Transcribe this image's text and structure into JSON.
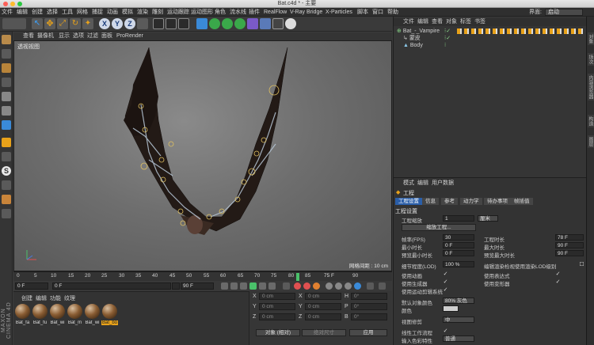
{
  "window": {
    "title": "Bat.c4d * - 主要"
  },
  "menubar": {
    "items": [
      "文件",
      "编辑",
      "创建",
      "选择",
      "工具",
      "网格",
      "捕捉",
      "动画",
      "模拟",
      "渲染",
      "雕刻",
      "运动跟踪",
      "运动图形",
      "角色",
      "流水线",
      "插件",
      "RealFlow",
      "V-Ray Bridge",
      "X-Particles",
      "脚本",
      "窗口",
      "帮助"
    ],
    "interface_label": "界面:",
    "interface_value": "启动"
  },
  "viewport": {
    "menu": [
      "查看",
      "摄像机",
      "显示",
      "选项",
      "过滤",
      "面板",
      "ProRender"
    ],
    "label": "透视视图",
    "grid_label": "网格间距 : 10 cm"
  },
  "timeline": {
    "ticks": [
      "0",
      "5",
      "10",
      "15",
      "20",
      "25",
      "30",
      "35",
      "40",
      "45",
      "50",
      "55",
      "60",
      "65",
      "70",
      "75",
      "80",
      "85",
      "90"
    ],
    "playhead_pct": 83.3,
    "current_frame": "75 F"
  },
  "playbar": {
    "start": "0 F",
    "current": "0 F",
    "end_preview": "90 F",
    "end": "90 F"
  },
  "materials": {
    "menu": [
      "创建",
      "编辑",
      "功能",
      "纹理"
    ],
    "items": [
      "Bat_fa",
      "Bat_fu",
      "Bat_wi",
      "Bat_m",
      "Bat_wi",
      "Bat_bo"
    ],
    "selected_index": 5
  },
  "brand": "MAXON CINEMA 4D",
  "coordinates": {
    "rows": [
      {
        "a": "X",
        "av": "0 cm",
        "b": "X",
        "bv": "0 cm",
        "c": "H",
        "cv": "0°"
      },
      {
        "a": "Y",
        "av": "0 cm",
        "b": "Y",
        "bv": "0 cm",
        "c": "P",
        "cv": "0°"
      },
      {
        "a": "Z",
        "av": "0 cm",
        "b": "Z",
        "bv": "0 cm",
        "c": "B",
        "cv": "0°"
      }
    ],
    "mode": "对象 (相对)",
    "size_mode": "绝对尺寸",
    "apply": "应用"
  },
  "object_manager": {
    "menu": [
      "文件",
      "编辑",
      "查看",
      "对象",
      "标签",
      "书签"
    ],
    "objects": [
      {
        "name": "Bat_-_Vampire",
        "indent": 0
      },
      {
        "name": "蒙皮",
        "indent": 1
      },
      {
        "name": "Body",
        "indent": 1
      }
    ]
  },
  "right_strip": [
    "对象",
    "场次",
    "内容浏览器",
    "构造",
    "图层"
  ],
  "attributes": {
    "menu": [
      "模式",
      "编辑",
      "用户数据"
    ],
    "title": "工程",
    "tabs": [
      "工程设置",
      "信息",
      "参考",
      "动力学",
      "待办事项",
      "帧插值"
    ],
    "active_tab": 0,
    "section": "工程设置",
    "scale_label": "工程缩放",
    "scale_value": "1",
    "scale_unit": "厘米",
    "scale_button": "缩放工程...",
    "fps_label": "帧率(FPS)",
    "fps_value": "30",
    "proj_len_label": "工程时长",
    "proj_len_value": "78 F",
    "min_label": "最小时长",
    "min_value": "0 F",
    "max_label": "最大时长",
    "max_value": "90 F",
    "prev_min_label": "预览最小时长",
    "prev_min_value": "0 F",
    "prev_max_label": "预览最大时长",
    "prev_max_value": "90 F",
    "lod_label": "细节程度(LOD)",
    "lod_value": "100 %",
    "lod_edit_label": "编辑渲染检视使用渲染LOD级别",
    "anim_label": "使用动画",
    "expr_label": "使用表达式",
    "gen_label": "使用生成器",
    "deform_label": "使用变形器",
    "motion_label": "使用运动剪辑系统",
    "objcolor_label": "默认对象颜色",
    "objcolor_value": "80% 灰色",
    "color_label": "颜色",
    "clip_label": "视图修剪",
    "clip_value": "中",
    "linear_label": "线性工作流程",
    "input_label": "输入色彩特性",
    "input_value": "普通"
  },
  "colors": {
    "accent": "#2a5ea8",
    "selection": "#e8a21a",
    "playhead": "#4ac06a"
  }
}
